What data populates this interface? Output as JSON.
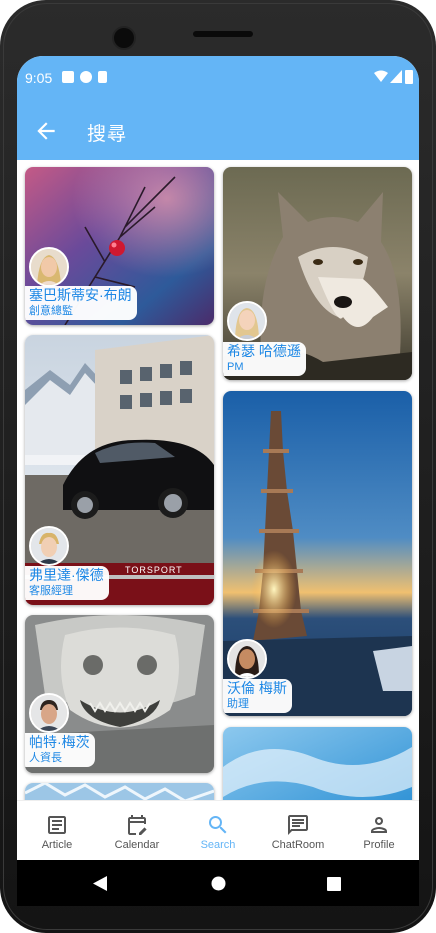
{
  "status": {
    "time": "9:05"
  },
  "appbar": {
    "title": "搜尋",
    "back_icon": "arrow-back-icon"
  },
  "theme": {
    "primary": "#64b5f6",
    "accent_text": "#1e88e5"
  },
  "cards": [
    {
      "name": "塞巴斯蒂安·布朗",
      "role": "創意總監",
      "image": "red-berry-branch",
      "avatar": "woman-blonde"
    },
    {
      "name": "希瑟 哈德遜",
      "role": "PM",
      "image": "wolf",
      "avatar": "woman-blonde-2"
    },
    {
      "name": "弗里達·傑德",
      "role": "客服經理",
      "image": "black-sports-car",
      "avatar": "man-blonde"
    },
    {
      "name": "沃倫 梅斯",
      "role": "助理",
      "image": "stacked-stones-sunset",
      "avatar": "woman-dark-hair"
    },
    {
      "name": "帕特·梅茨",
      "role": "人資長",
      "image": "stone-dragon-statue",
      "avatar": "man-dark-hair"
    },
    {
      "image": "blue-sky-clouds"
    },
    {
      "image": "blue-pattern"
    }
  ],
  "car_banner": {
    "text": "TORSPORT"
  },
  "bottom_nav": [
    {
      "label": "Article",
      "icon": "article-icon"
    },
    {
      "label": "Calendar",
      "icon": "calendar-edit-icon"
    },
    {
      "label": "Search",
      "icon": "search-icon",
      "active": true
    },
    {
      "label": "ChatRoom",
      "icon": "chat-icon"
    },
    {
      "label": "Profile",
      "icon": "person-icon"
    }
  ],
  "system_nav": [
    "back-triangle-icon",
    "home-circle-icon",
    "recents-square-icon"
  ]
}
